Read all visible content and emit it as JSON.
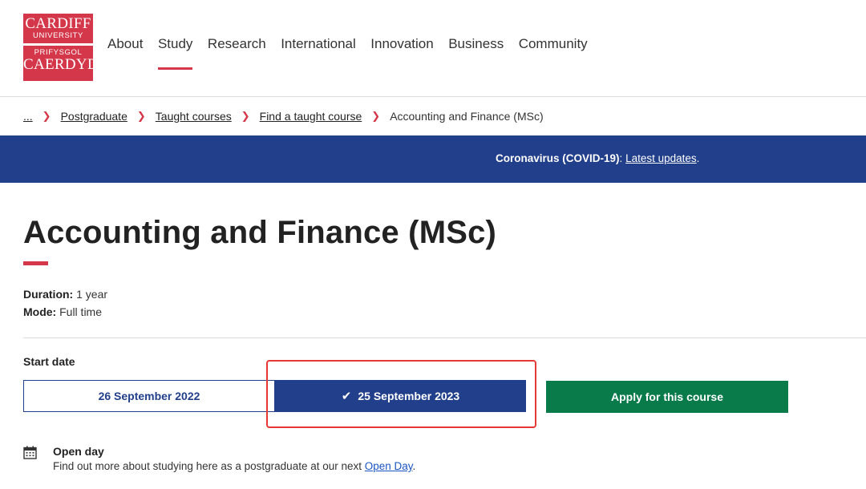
{
  "logo": {
    "line1": "CARDIFF",
    "line2": "UNIVERSITY",
    "line3": "PRIFYSGOL",
    "line4": "CAERDYDD"
  },
  "nav": {
    "items": [
      "About",
      "Study",
      "Research",
      "International",
      "Innovation",
      "Business",
      "Community"
    ],
    "active": "Study"
  },
  "breadcrumb": {
    "ellipsis": "...",
    "links": [
      "Postgraduate",
      "Taught courses",
      "Find a taught course"
    ],
    "current": "Accounting and Finance (MSc)"
  },
  "banner": {
    "label": "Coronavirus (COVID-19)",
    "colon": ":",
    "link": "Latest updates",
    "period": "."
  },
  "course": {
    "title": "Accounting and Finance (MSc)",
    "duration_label": "Duration:",
    "duration_value": "1 year",
    "mode_label": "Mode:",
    "mode_value": "Full time"
  },
  "start": {
    "label": "Start date",
    "dates": [
      "26 September 2022",
      "25 September 2023"
    ],
    "selected": "25 September 2023"
  },
  "apply": {
    "label": "Apply for this course"
  },
  "open_day": {
    "title": "Open day",
    "text": "Find out more about studying here as a postgraduate at our next ",
    "link": "Open Day",
    "end": "."
  },
  "colors": {
    "brand_red": "#d4374a",
    "navy": "#223f8b",
    "green": "#097a4a",
    "highlight": "#e53935"
  }
}
